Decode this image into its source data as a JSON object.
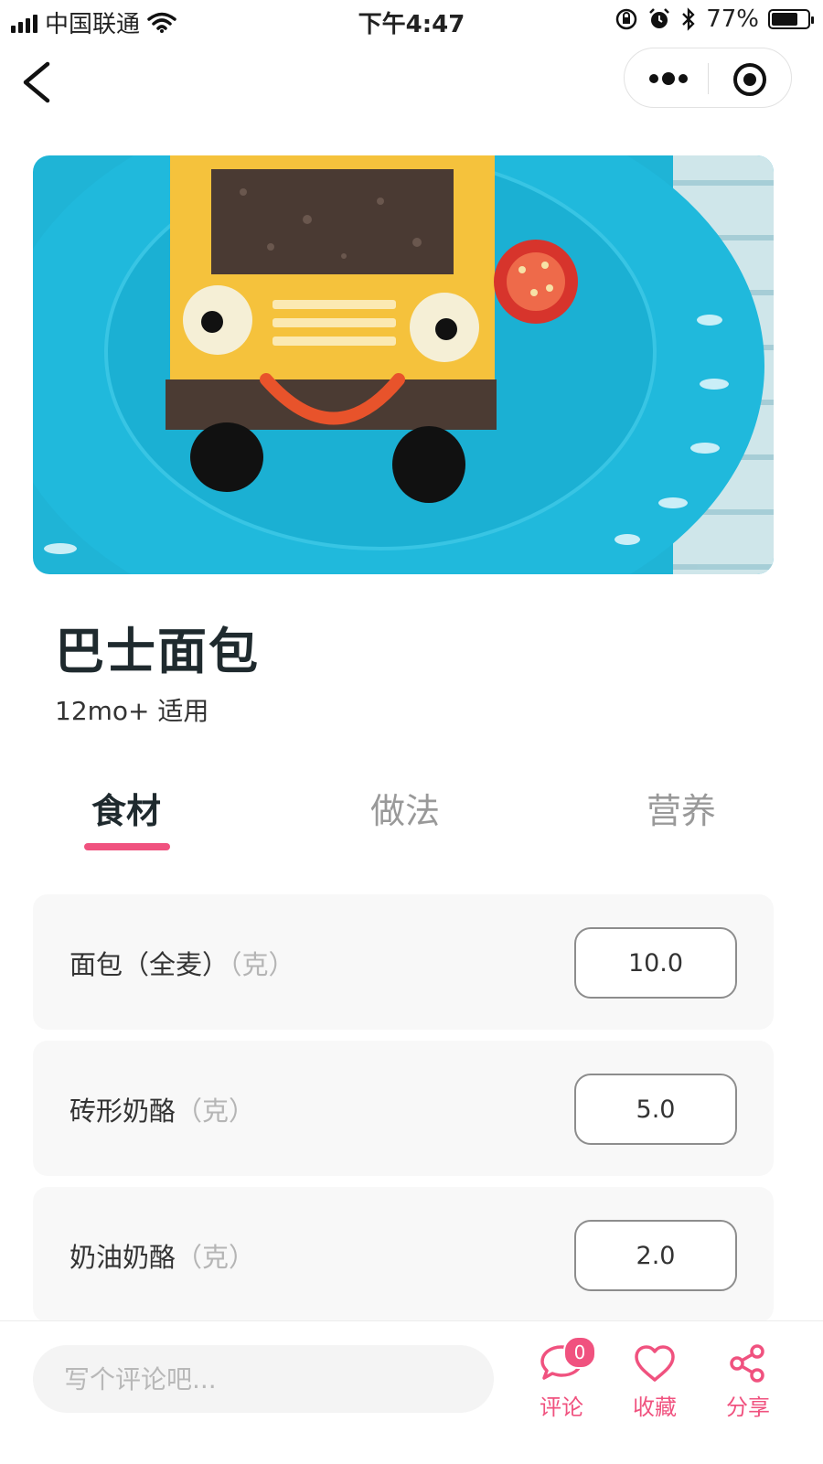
{
  "status_bar": {
    "carrier": "中国联通",
    "time": "下午4:47",
    "battery_percent": "77%",
    "battery_level": 0.77
  },
  "nav": {
    "back_icon": "chevron-left-icon",
    "more_icon": "more-dots-icon",
    "target_icon": "target-icon"
  },
  "recipe": {
    "title": "巴士面包",
    "age": "12mo+ 适用"
  },
  "tabs": [
    {
      "label": "食材",
      "active": true
    },
    {
      "label": "做法",
      "active": false
    },
    {
      "label": "营养",
      "active": false
    }
  ],
  "ingredients": [
    {
      "name": "面包（全麦）",
      "unit": "（克）",
      "quantity": "10.0"
    },
    {
      "name": "砖形奶酪",
      "unit": "（克）",
      "quantity": "5.0"
    },
    {
      "name": "奶油奶酪",
      "unit": "（克）",
      "quantity": "2.0"
    }
  ],
  "bottom_bar": {
    "comment_placeholder": "写个评论吧...",
    "comment_label": "评论",
    "comment_count": "0",
    "favorite_label": "收藏",
    "share_label": "分享"
  },
  "colors": {
    "accent": "#f0527f",
    "title": "#1f2a2e",
    "card_bg": "#f8f8f8"
  }
}
